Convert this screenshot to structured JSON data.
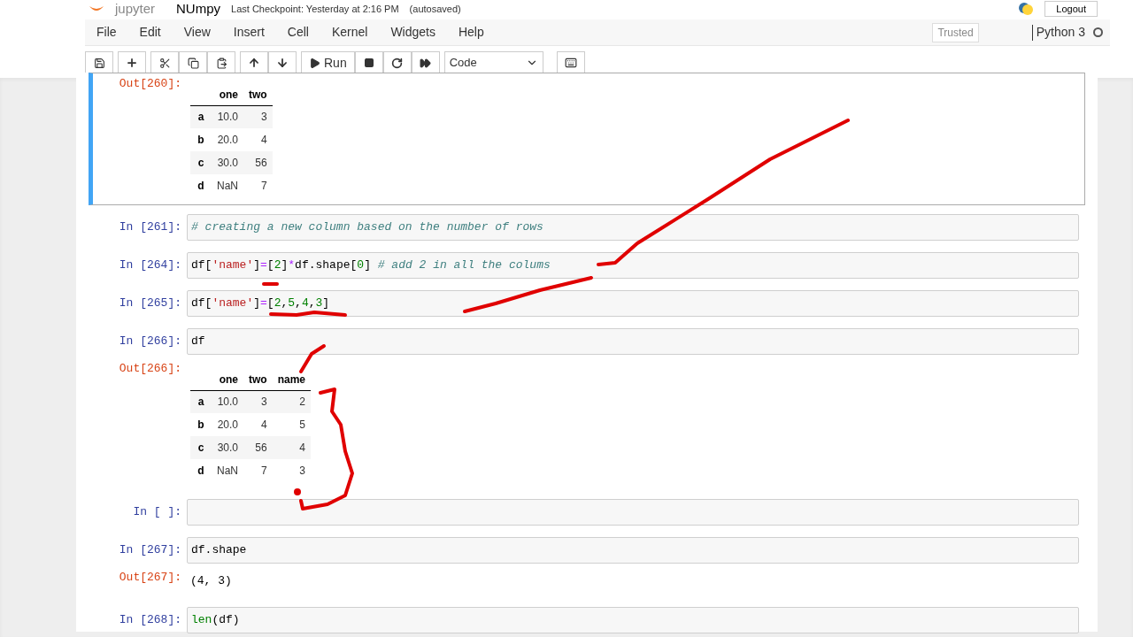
{
  "header": {
    "logo": "jupyter",
    "notebook_name": "NUmpy",
    "checkpoint": "Last Checkpoint: Yesterday at 2:16 PM",
    "autosave": "(autosaved)",
    "logout": "Logout"
  },
  "menu": [
    "File",
    "Edit",
    "View",
    "Insert",
    "Cell",
    "Kernel",
    "Widgets",
    "Help"
  ],
  "status": {
    "trusted": "Trusted",
    "kernel": "Python 3",
    "kernel_busy": false
  },
  "toolbar": {
    "run_label": "Run",
    "cell_type": "Code"
  },
  "cells": [
    {
      "selected": true,
      "out_prompt": "Out[260]:",
      "table": {
        "columns": [
          "one",
          "two"
        ],
        "rows": [
          {
            "index": "a",
            "values": [
              "10.0",
              "3"
            ]
          },
          {
            "index": "b",
            "values": [
              "20.0",
              "4"
            ]
          },
          {
            "index": "c",
            "values": [
              "30.0",
              "56"
            ]
          },
          {
            "index": "d",
            "values": [
              "NaN",
              "7"
            ]
          }
        ]
      }
    },
    {
      "selected": false,
      "in_prompt": "In [261]:",
      "code": [
        {
          "kind": "comment",
          "text": "# creating a new column based on the number of rows"
        }
      ]
    },
    {
      "selected": false,
      "in_prompt": "In [264]:",
      "code": [
        {
          "kind": "plain",
          "text": "df["
        },
        {
          "kind": "string",
          "text": "'name'"
        },
        {
          "kind": "plain",
          "text": "]"
        },
        {
          "kind": "operator",
          "text": "="
        },
        {
          "kind": "plain",
          "text": "["
        },
        {
          "kind": "number",
          "text": "2"
        },
        {
          "kind": "plain",
          "text": "]"
        },
        {
          "kind": "operator",
          "text": "*"
        },
        {
          "kind": "plain",
          "text": "df.shape["
        },
        {
          "kind": "number",
          "text": "0"
        },
        {
          "kind": "plain",
          "text": "] "
        },
        {
          "kind": "comment",
          "text": "# add 2 in all the colums"
        }
      ]
    },
    {
      "selected": false,
      "in_prompt": "In [265]:",
      "code": [
        {
          "kind": "plain",
          "text": "df["
        },
        {
          "kind": "string",
          "text": "'name'"
        },
        {
          "kind": "plain",
          "text": "]"
        },
        {
          "kind": "operator",
          "text": "="
        },
        {
          "kind": "plain",
          "text": "["
        },
        {
          "kind": "number",
          "text": "2"
        },
        {
          "kind": "plain",
          "text": ","
        },
        {
          "kind": "number",
          "text": "5"
        },
        {
          "kind": "plain",
          "text": ","
        },
        {
          "kind": "number",
          "text": "4"
        },
        {
          "kind": "plain",
          "text": ","
        },
        {
          "kind": "number",
          "text": "3"
        },
        {
          "kind": "plain",
          "text": "]"
        }
      ]
    },
    {
      "selected": false,
      "in_prompt": "In [266]:",
      "code": [
        {
          "kind": "plain",
          "text": "df"
        }
      ],
      "out_prompt": "Out[266]:",
      "table": {
        "columns": [
          "one",
          "two",
          "name"
        ],
        "rows": [
          {
            "index": "a",
            "values": [
              "10.0",
              "3",
              "2"
            ]
          },
          {
            "index": "b",
            "values": [
              "20.0",
              "4",
              "5"
            ]
          },
          {
            "index": "c",
            "values": [
              "30.0",
              "56",
              "4"
            ]
          },
          {
            "index": "d",
            "values": [
              "NaN",
              "7",
              "3"
            ]
          }
        ]
      }
    },
    {
      "selected": false,
      "in_prompt": "In [ ]:"
    },
    {
      "selected": false,
      "in_prompt": "In [267]:",
      "code": [
        {
          "kind": "plain",
          "text": "df.shape"
        }
      ],
      "out_prompt": "Out[267]:",
      "output_text": "(4, 3)"
    },
    {
      "selected": false,
      "in_prompt": "In [268]:",
      "code": [
        {
          "kind": "builtin",
          "text": "len"
        },
        {
          "kind": "plain",
          "text": "(df)"
        }
      ]
    }
  ]
}
